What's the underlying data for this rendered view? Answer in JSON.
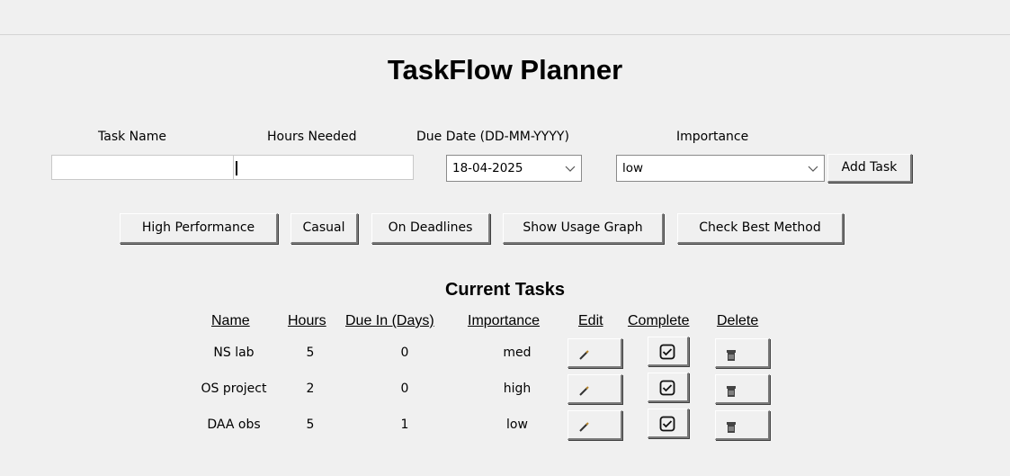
{
  "app": {
    "title": "TaskFlow Planner"
  },
  "form": {
    "task_name_label": "Task Name",
    "hours_label": "Hours Needed",
    "due_date_label": "Due Date (DD-MM-YYYY)",
    "importance_label": "Importance",
    "task_name_value": "",
    "hours_value": "",
    "due_date_value": "18-04-2025",
    "importance_value": "low",
    "add_task_label": "Add Task"
  },
  "actions": {
    "high_performance": "High Performance",
    "casual": "Casual",
    "on_deadlines": "On Deadlines",
    "show_usage_graph": "Show Usage Graph",
    "check_best_method": "Check Best Method"
  },
  "tasks": {
    "title": "Current Tasks",
    "headers": {
      "name": "Name",
      "hours": "Hours",
      "due_in": "Due In (Days)",
      "importance": "Importance",
      "edit": "Edit",
      "complete": "Complete",
      "delete": "Delete"
    },
    "rows": [
      {
        "name": "NS lab",
        "hours": "5",
        "due_in": "0",
        "importance": "med"
      },
      {
        "name": "OS project",
        "hours": "2",
        "due_in": "0",
        "importance": "high"
      },
      {
        "name": "DAA obs",
        "hours": "5",
        "due_in": "1",
        "importance": "low"
      }
    ]
  },
  "icons": {
    "edit": "pencil-icon",
    "complete": "checkbox-icon",
    "delete": "trash-icon"
  }
}
